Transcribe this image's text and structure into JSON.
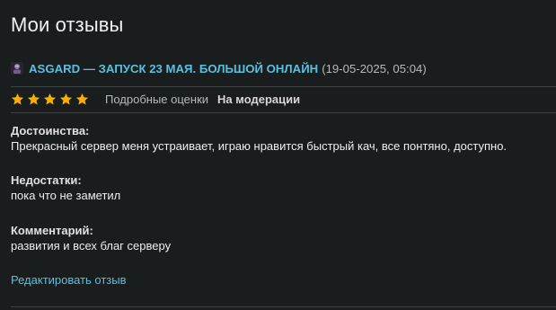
{
  "page": {
    "title": "Мои отзывы"
  },
  "review": {
    "server_icon": "server-avatar-icon",
    "server_name": "ASGARD — ЗАПУСК 23 МАЯ. БОЛЬШОЙ ОНЛАЙН",
    "date": "(19-05-2025, 05:04)",
    "rating": 5,
    "rating_max": 5,
    "star_color": "#f5b301",
    "detailed_ratings_label": "Подробные оценки",
    "status": "На модерации",
    "pros_label": "Достоинства:",
    "pros_text": "Прекрасный сервер меня устраивает, играю нравится быстрый кач, все понтяно, доступно.",
    "cons_label": "Недостатки:",
    "cons_text": "пока что не заметил",
    "comment_label": "Комментарий:",
    "comment_text": "развития и всех благ серверу",
    "edit_label": "Редактировать отзыв"
  },
  "colors": {
    "background": "#1a1d1e",
    "link": "#5bc0de",
    "divider": "#3c4143"
  }
}
